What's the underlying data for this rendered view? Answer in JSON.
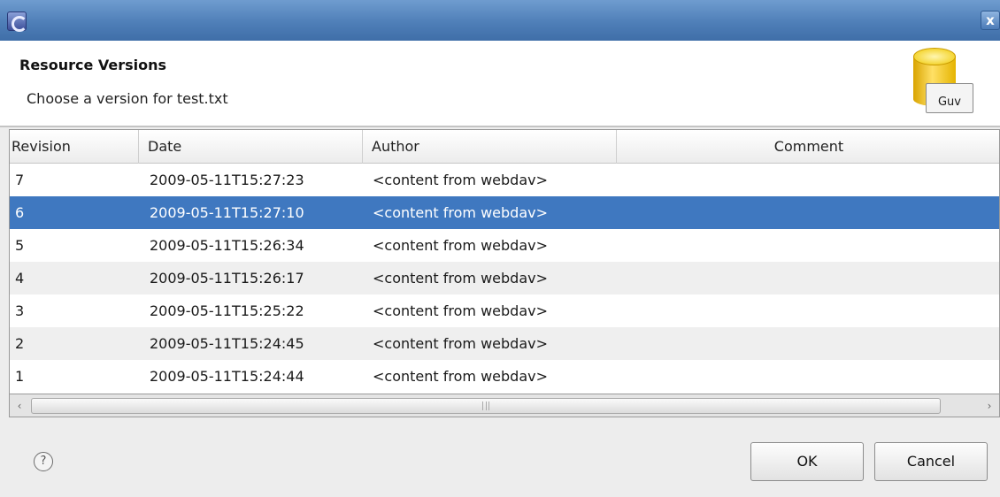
{
  "titlebar": {
    "close_glyph": "x"
  },
  "header": {
    "title": "Resource Versions",
    "message": "Choose a version for test.txt",
    "image_label": "Guv"
  },
  "table": {
    "columns": [
      "Revision",
      "Date",
      "Author",
      "Comment"
    ],
    "rows": [
      {
        "revision": "7",
        "date": "2009-05-11T15:27:23",
        "author": "<content from webdav>",
        "comment": ""
      },
      {
        "revision": "6",
        "date": "2009-05-11T15:27:10",
        "author": "<content from webdav>",
        "comment": ""
      },
      {
        "revision": "5",
        "date": "2009-05-11T15:26:34",
        "author": "<content from webdav>",
        "comment": ""
      },
      {
        "revision": "4",
        "date": "2009-05-11T15:26:17",
        "author": "<content from webdav>",
        "comment": ""
      },
      {
        "revision": "3",
        "date": "2009-05-11T15:25:22",
        "author": "<content from webdav>",
        "comment": ""
      },
      {
        "revision": "2",
        "date": "2009-05-11T15:24:45",
        "author": "<content from webdav>",
        "comment": ""
      },
      {
        "revision": "1",
        "date": "2009-05-11T15:24:44",
        "author": "<content from webdav>",
        "comment": ""
      }
    ],
    "selected_revision": "6"
  },
  "footer": {
    "help_glyph": "?",
    "ok_label": "OK",
    "cancel_label": "Cancel"
  },
  "colors": {
    "titlebar": "#4f7fb8",
    "selection": "#3f78c0",
    "row_alt": "#efefef"
  }
}
